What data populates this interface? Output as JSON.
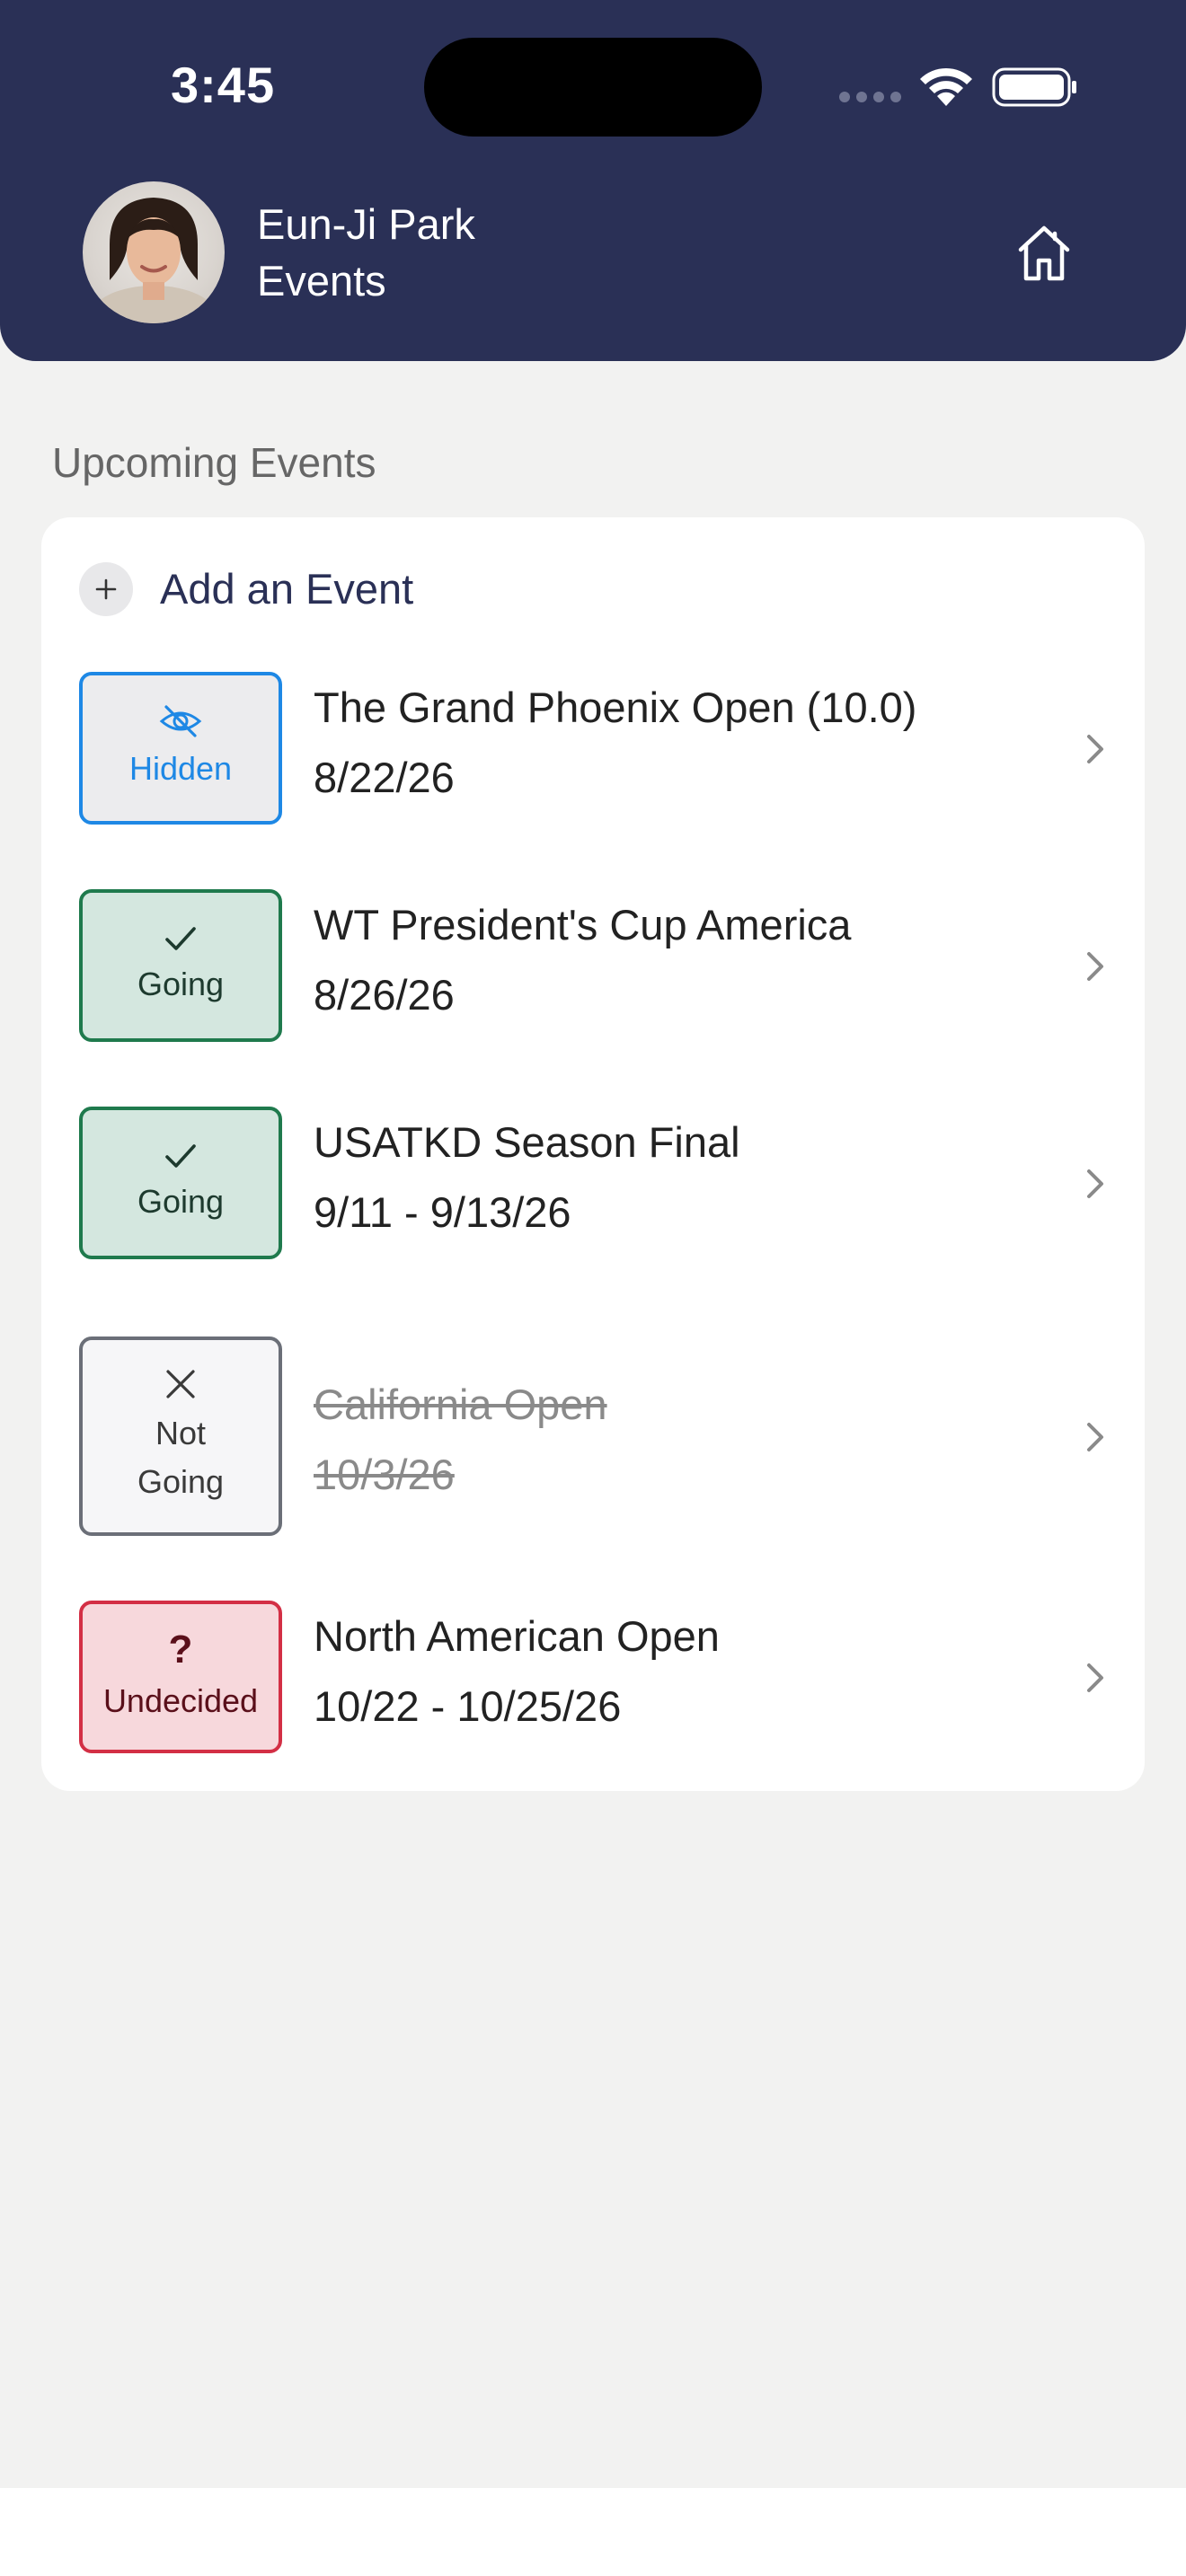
{
  "status_bar": {
    "time": "3:45"
  },
  "header": {
    "user_name": "Eun-Ji Park",
    "page_title": "Events"
  },
  "section": {
    "title": "Upcoming Events"
  },
  "add_event": {
    "label": "Add an Event"
  },
  "events": [
    {
      "status": "Hidden",
      "title": "The Grand Phoenix Open (10.0)",
      "date": "8/22/26"
    },
    {
      "status": "Going",
      "title": "WT President's Cup America",
      "date": "8/26/26"
    },
    {
      "status": "Going",
      "title": "USATKD Season Final",
      "date": "9/11 - 9/13/26"
    },
    {
      "status_line1": "Not",
      "status_line2": "Going",
      "title": "California Open",
      "date": "10/3/26"
    },
    {
      "status": "Undecided",
      "title": "North American Open",
      "date": "10/22 - 10/25/26"
    }
  ],
  "colors": {
    "header_bg": "#2a3056",
    "hidden": "#1e88e5",
    "going": "#1f7a4d",
    "not_going": "#6b6f78",
    "undecided": "#d32f45"
  },
  "icons": {
    "hidden": "eye-slash-icon",
    "going": "checkmark-icon",
    "not_going": "x-mark-icon",
    "undecided": "question-mark-icon",
    "add": "plus-icon",
    "home": "home-icon",
    "row": "chevron-right-icon"
  }
}
